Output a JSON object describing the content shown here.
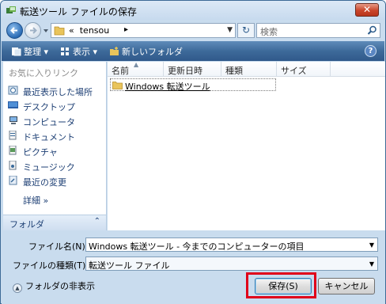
{
  "window": {
    "title": "転送ツール ファイルの保存",
    "close_label": "✕"
  },
  "address": {
    "prefix": "«",
    "path": "tensou",
    "separator": "▸",
    "search_placeholder": "検索"
  },
  "toolbar": {
    "organize_label": "整理 ▾",
    "view_label": "表示 ▾",
    "new_folder_label": "新しいフォルダ",
    "help_label": "?"
  },
  "sidebar": {
    "favorites_heading": "お気に入りリンク",
    "items": [
      {
        "label": "最近表示した場所",
        "icon": "recent-places-icon"
      },
      {
        "label": "デスクトップ",
        "icon": "desktop-icon"
      },
      {
        "label": "コンピュータ",
        "icon": "computer-icon"
      },
      {
        "label": "ドキュメント",
        "icon": "documents-icon"
      },
      {
        "label": "ピクチャ",
        "icon": "pictures-icon"
      },
      {
        "label": "ミュージック",
        "icon": "music-icon"
      },
      {
        "label": "最近の変更",
        "icon": "recent-changes-icon"
      }
    ],
    "more_label": "詳細 »",
    "folders_label": "フォルダ",
    "folders_chevron": "⌃"
  },
  "file_list": {
    "columns": [
      "名前",
      "更新日時",
      "種類",
      "サイズ"
    ],
    "files": [
      {
        "name": "Windows 転送ツール",
        "icon": "folder-icon"
      }
    ]
  },
  "form": {
    "filename_label": "ファイル名(N):",
    "filename_value": "Windows 転送ツール - 今までのコンピューターの項目",
    "filetype_label": "ファイルの種類(T):",
    "filetype_value": "転送ツール ファイル",
    "hide_folders_label": "フォルダの非表示",
    "save_label": "保存(S)",
    "cancel_label": "キャンセル"
  },
  "colors": {
    "highlight_frame": "#e0001a",
    "toolbar": "#3d6a9a",
    "window_frame": "#c9dcee"
  }
}
